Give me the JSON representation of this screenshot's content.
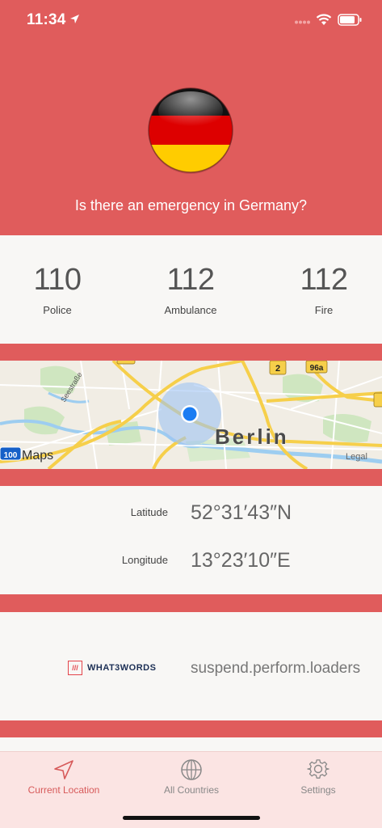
{
  "status": {
    "time": "11:34"
  },
  "header": {
    "question": "Is there an emergency in Germany?"
  },
  "numbers": [
    {
      "value": "110",
      "label": "Police"
    },
    {
      "value": "112",
      "label": "Ambulance"
    },
    {
      "value": "112",
      "label": "Fire"
    }
  ],
  "map": {
    "city_label": "Berlin",
    "maps_label": "Maps",
    "legal_label": "Legal",
    "road_badges": [
      "2",
      "96a",
      "100"
    ],
    "street_labels": [
      "Seestraße"
    ]
  },
  "coords": {
    "lat_label": "Latitude",
    "lat_value": "52°31′43″N",
    "lon_label": "Longitude",
    "lon_value": "13°23′10″E"
  },
  "w3w": {
    "brand": "WHAT3WORDS",
    "words": "suspend.perform.loaders"
  },
  "tabs": [
    {
      "label": "Current Location",
      "active": true
    },
    {
      "label": "All Countries",
      "active": false
    },
    {
      "label": "Settings",
      "active": false
    }
  ],
  "colors": {
    "accent": "#e05c5c",
    "card": "#f8f7f5",
    "tab_active": "#d75a5a"
  }
}
